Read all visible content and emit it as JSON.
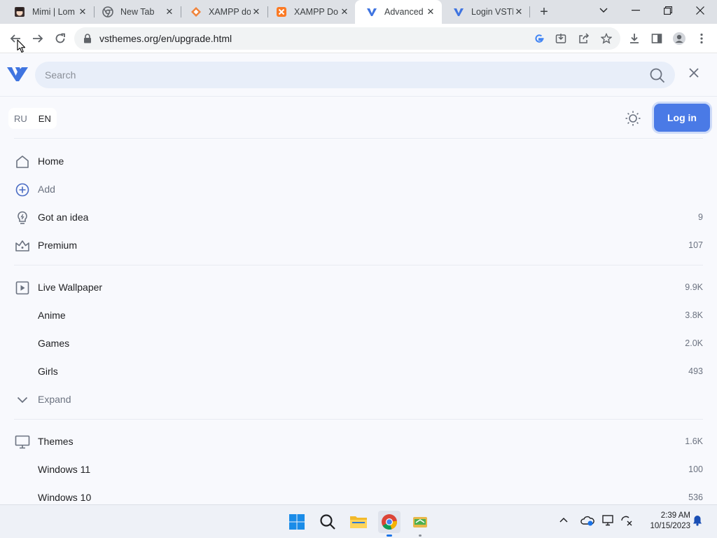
{
  "browser": {
    "tabs": [
      {
        "title": "Mimi | Lom",
        "favicon": "anime-avatar-icon",
        "active": false
      },
      {
        "title": "New Tab",
        "favicon": "chrome-icon",
        "active": false
      },
      {
        "title": "XAMPP do",
        "favicon": "xampp-diamond-icon",
        "active": false
      },
      {
        "title": "XAMPP Do",
        "favicon": "xampp-icon",
        "active": false
      },
      {
        "title": "Advanced",
        "favicon": "vsthemes-icon",
        "active": true
      },
      {
        "title": "Login VSTh",
        "favicon": "vsthemes-icon",
        "active": false
      }
    ],
    "url": "vsthemes.org/en/upgrade.html"
  },
  "page": {
    "search": {
      "placeholder": "Search"
    },
    "lang": {
      "ru": "RU",
      "en": "EN",
      "selected": "EN"
    },
    "login_label": "Log in",
    "nav": [
      {
        "label": "Home",
        "icon": "home-icon",
        "count": ""
      },
      {
        "label": "Add",
        "icon": "plus-circle-icon",
        "count": ""
      },
      {
        "label": "Got an idea",
        "icon": "lightbulb-icon",
        "count": "9"
      },
      {
        "label": "Premium",
        "icon": "crown-icon",
        "count": "107"
      },
      {
        "label": "Live Wallpaper",
        "icon": "play-square-icon",
        "count": "9.9K"
      },
      {
        "label": "Anime",
        "icon": "",
        "count": "3.8K"
      },
      {
        "label": "Games",
        "icon": "",
        "count": "2.0K"
      },
      {
        "label": "Girls",
        "icon": "",
        "count": "493"
      },
      {
        "label": "Expand",
        "icon": "chevron-down-icon",
        "count": ""
      },
      {
        "label": "Themes",
        "icon": "monitor-icon",
        "count": "1.6K"
      },
      {
        "label": "Windows 11",
        "icon": "",
        "count": "100"
      },
      {
        "label": "Windows 10",
        "icon": "",
        "count": "536"
      }
    ]
  },
  "taskbar": {
    "time": "2:39 AM",
    "date": "10/15/2023"
  },
  "colors": {
    "accent": "#4a7ae6",
    "page_bg": "#f8f9fd",
    "search_bg": "#e8eef9"
  }
}
